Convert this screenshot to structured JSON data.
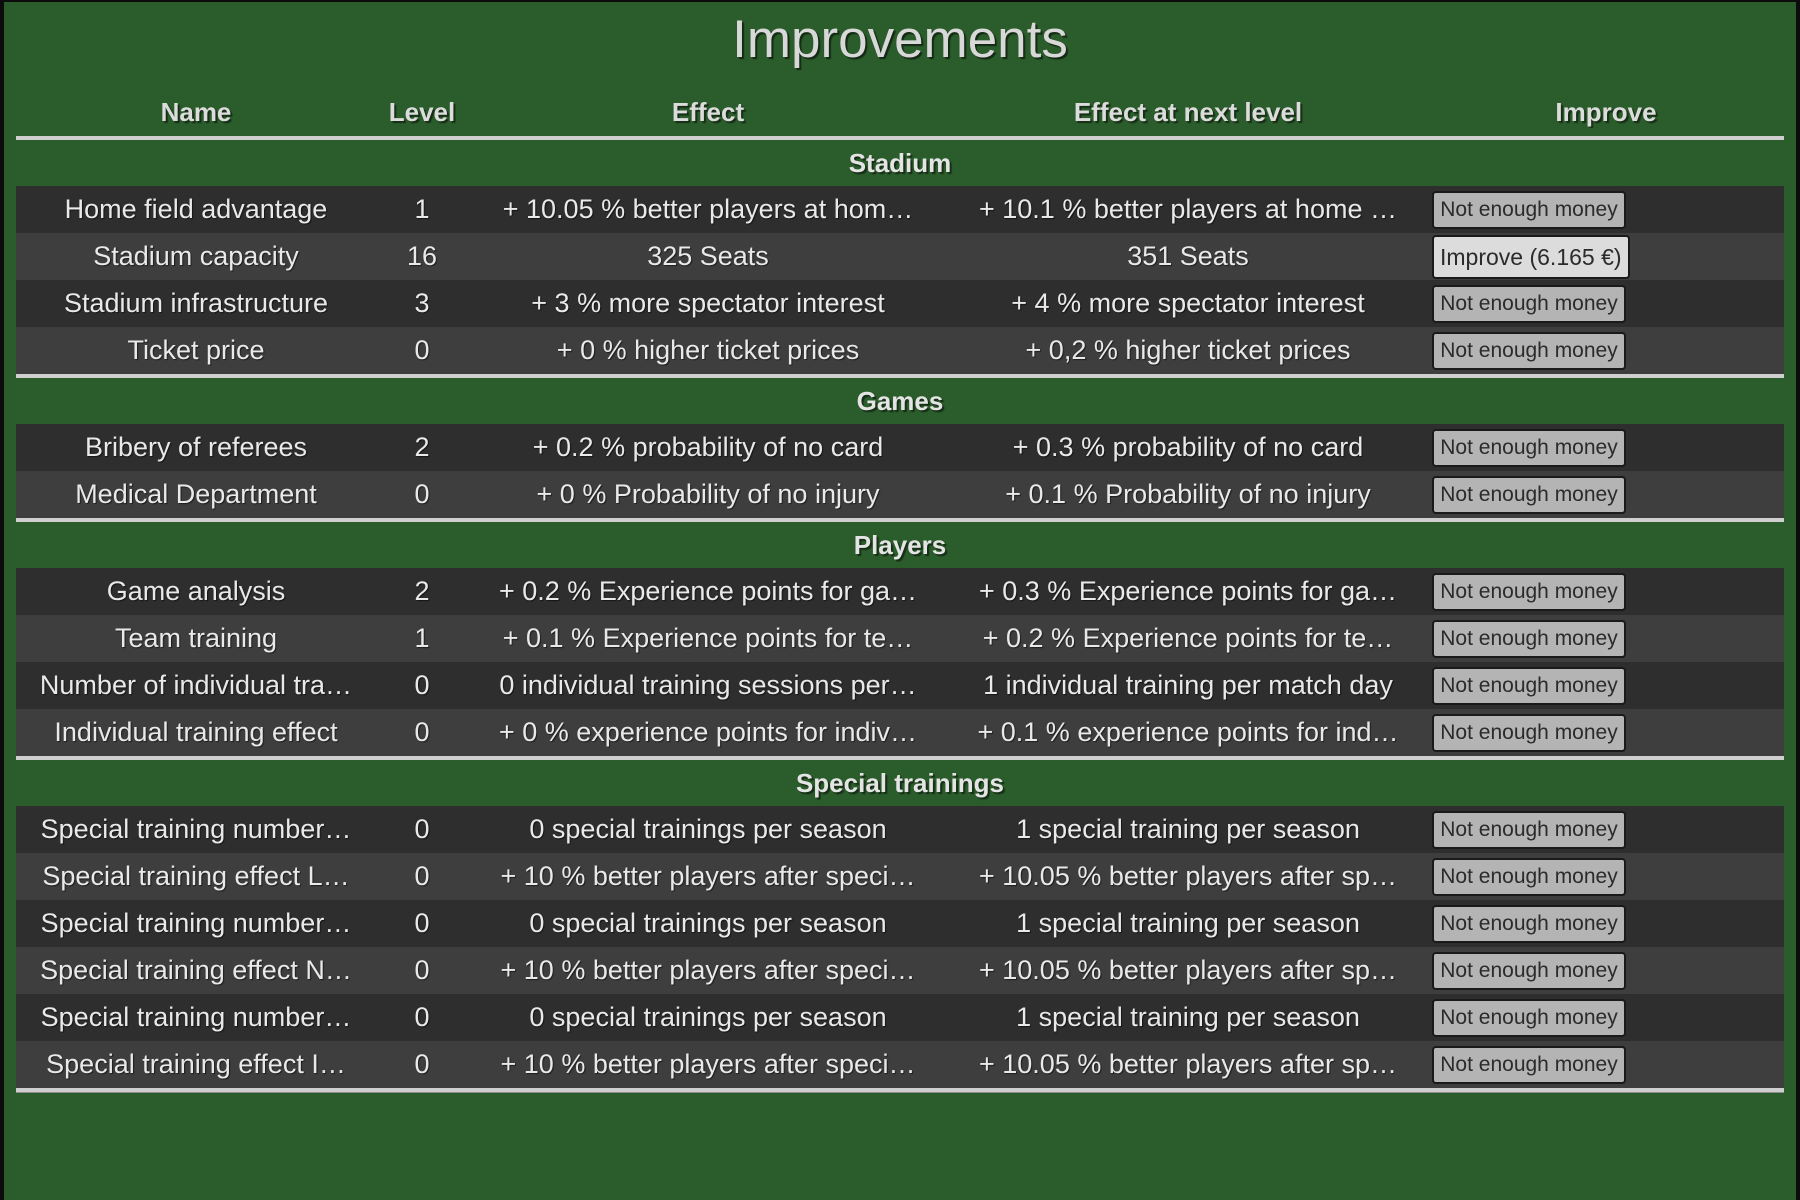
{
  "page": {
    "title": "Improvements",
    "accent_green": "#2b5c2b",
    "row_dark": "#2e2e2e",
    "row_light": "#3e3e3e"
  },
  "columns": {
    "name": "Name",
    "level": "Level",
    "effect": "Effect",
    "next": "Effect at next level",
    "improve": "Improve"
  },
  "buttons": {
    "not_enough": "Not enough money",
    "improve_stadium_capacity": "Improve (6.165 €)"
  },
  "sections": [
    {
      "title": "Stadium",
      "rows": [
        {
          "name": "Home field advantage",
          "level": "1",
          "effect": "+ 10.05 % better players at hom…",
          "next": "+ 10.1 % better players at home …",
          "button": "Not enough money",
          "enabled": false
        },
        {
          "name": "Stadium capacity",
          "level": "16",
          "effect": "325 Seats",
          "next": "351 Seats",
          "button": "Improve (6.165 €)",
          "enabled": true
        },
        {
          "name": "Stadium infrastructure",
          "level": "3",
          "effect": "+ 3 % more spectator interest",
          "next": "+ 4 % more spectator interest",
          "button": "Not enough money",
          "enabled": false
        },
        {
          "name": "Ticket price",
          "level": "0",
          "effect": "+ 0 % higher ticket prices",
          "next": "+ 0,2 % higher ticket prices",
          "button": "Not enough money",
          "enabled": false
        }
      ]
    },
    {
      "title": "Games",
      "rows": [
        {
          "name": "Bribery of referees",
          "level": "2",
          "effect": "+ 0.2 % probability of no card",
          "next": "+ 0.3 % probability of no card",
          "button": "Not enough money",
          "enabled": false
        },
        {
          "name": "Medical Department",
          "level": "0",
          "effect": "+ 0 % Probability of no injury",
          "next": "+ 0.1 % Probability of no injury",
          "button": "Not enough money",
          "enabled": false
        }
      ]
    },
    {
      "title": "Players",
      "rows": [
        {
          "name": "Game analysis",
          "level": "2",
          "effect": "+ 0.2 % Experience points for ga…",
          "next": "+ 0.3 % Experience points for ga…",
          "button": "Not enough money",
          "enabled": false
        },
        {
          "name": "Team training",
          "level": "1",
          "effect": "+ 0.1 % Experience points for te…",
          "next": "+ 0.2 % Experience points for te…",
          "button": "Not enough money",
          "enabled": false
        },
        {
          "name": "Number of individual tra…",
          "level": "0",
          "effect": "0 individual training sessions per…",
          "next": "1 individual training per match day",
          "button": "Not enough money",
          "enabled": false
        },
        {
          "name": "Individual training effect",
          "level": "0",
          "effect": "+ 0 % experience points for indiv…",
          "next": "+ 0.1 % experience points for ind…",
          "button": "Not enough money",
          "enabled": false
        }
      ]
    },
    {
      "title": "Special trainings",
      "rows": [
        {
          "name": "Special training number…",
          "level": "0",
          "effect": "0 special trainings per season",
          "next": "1 special training per season",
          "button": "Not enough money",
          "enabled": false
        },
        {
          "name": "Special training effect L…",
          "level": "0",
          "effect": "+ 10 % better players after speci…",
          "next": "+ 10.05 % better players after sp…",
          "button": "Not enough money",
          "enabled": false
        },
        {
          "name": "Special training number…",
          "level": "0",
          "effect": "0 special trainings per season",
          "next": "1 special training per season",
          "button": "Not enough money",
          "enabled": false
        },
        {
          "name": "Special training effect N…",
          "level": "0",
          "effect": "+ 10 % better players after speci…",
          "next": "+ 10.05 % better players after sp…",
          "button": "Not enough money",
          "enabled": false
        },
        {
          "name": "Special training number…",
          "level": "0",
          "effect": "0 special trainings per season",
          "next": "1 special training per season",
          "button": "Not enough money",
          "enabled": false
        },
        {
          "name": "Special training effect I…",
          "level": "0",
          "effect": "+ 10 % better players after speci…",
          "next": "+ 10.05 % better players after sp…",
          "button": "Not enough money",
          "enabled": false
        }
      ]
    }
  ]
}
